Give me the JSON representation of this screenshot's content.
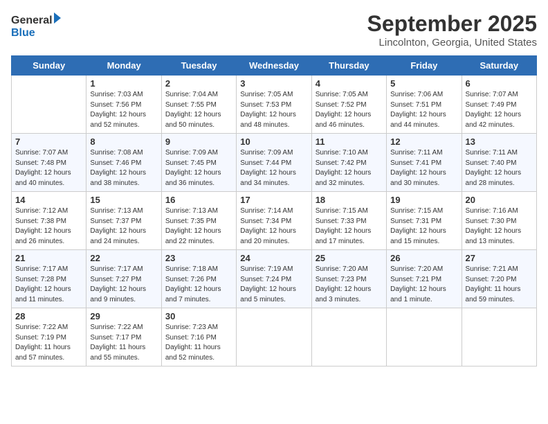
{
  "logo": {
    "line1": "General",
    "line2": "Blue"
  },
  "title": "September 2025",
  "location": "Lincolnton, Georgia, United States",
  "days_of_week": [
    "Sunday",
    "Monday",
    "Tuesday",
    "Wednesday",
    "Thursday",
    "Friday",
    "Saturday"
  ],
  "weeks": [
    [
      {
        "day": "",
        "info": ""
      },
      {
        "day": "1",
        "info": "Sunrise: 7:03 AM\nSunset: 7:56 PM\nDaylight: 12 hours\nand 52 minutes."
      },
      {
        "day": "2",
        "info": "Sunrise: 7:04 AM\nSunset: 7:55 PM\nDaylight: 12 hours\nand 50 minutes."
      },
      {
        "day": "3",
        "info": "Sunrise: 7:05 AM\nSunset: 7:53 PM\nDaylight: 12 hours\nand 48 minutes."
      },
      {
        "day": "4",
        "info": "Sunrise: 7:05 AM\nSunset: 7:52 PM\nDaylight: 12 hours\nand 46 minutes."
      },
      {
        "day": "5",
        "info": "Sunrise: 7:06 AM\nSunset: 7:51 PM\nDaylight: 12 hours\nand 44 minutes."
      },
      {
        "day": "6",
        "info": "Sunrise: 7:07 AM\nSunset: 7:49 PM\nDaylight: 12 hours\nand 42 minutes."
      }
    ],
    [
      {
        "day": "7",
        "info": "Sunrise: 7:07 AM\nSunset: 7:48 PM\nDaylight: 12 hours\nand 40 minutes."
      },
      {
        "day": "8",
        "info": "Sunrise: 7:08 AM\nSunset: 7:46 PM\nDaylight: 12 hours\nand 38 minutes."
      },
      {
        "day": "9",
        "info": "Sunrise: 7:09 AM\nSunset: 7:45 PM\nDaylight: 12 hours\nand 36 minutes."
      },
      {
        "day": "10",
        "info": "Sunrise: 7:09 AM\nSunset: 7:44 PM\nDaylight: 12 hours\nand 34 minutes."
      },
      {
        "day": "11",
        "info": "Sunrise: 7:10 AM\nSunset: 7:42 PM\nDaylight: 12 hours\nand 32 minutes."
      },
      {
        "day": "12",
        "info": "Sunrise: 7:11 AM\nSunset: 7:41 PM\nDaylight: 12 hours\nand 30 minutes."
      },
      {
        "day": "13",
        "info": "Sunrise: 7:11 AM\nSunset: 7:40 PM\nDaylight: 12 hours\nand 28 minutes."
      }
    ],
    [
      {
        "day": "14",
        "info": "Sunrise: 7:12 AM\nSunset: 7:38 PM\nDaylight: 12 hours\nand 26 minutes."
      },
      {
        "day": "15",
        "info": "Sunrise: 7:13 AM\nSunset: 7:37 PM\nDaylight: 12 hours\nand 24 minutes."
      },
      {
        "day": "16",
        "info": "Sunrise: 7:13 AM\nSunset: 7:35 PM\nDaylight: 12 hours\nand 22 minutes."
      },
      {
        "day": "17",
        "info": "Sunrise: 7:14 AM\nSunset: 7:34 PM\nDaylight: 12 hours\nand 20 minutes."
      },
      {
        "day": "18",
        "info": "Sunrise: 7:15 AM\nSunset: 7:33 PM\nDaylight: 12 hours\nand 17 minutes."
      },
      {
        "day": "19",
        "info": "Sunrise: 7:15 AM\nSunset: 7:31 PM\nDaylight: 12 hours\nand 15 minutes."
      },
      {
        "day": "20",
        "info": "Sunrise: 7:16 AM\nSunset: 7:30 PM\nDaylight: 12 hours\nand 13 minutes."
      }
    ],
    [
      {
        "day": "21",
        "info": "Sunrise: 7:17 AM\nSunset: 7:28 PM\nDaylight: 12 hours\nand 11 minutes."
      },
      {
        "day": "22",
        "info": "Sunrise: 7:17 AM\nSunset: 7:27 PM\nDaylight: 12 hours\nand 9 minutes."
      },
      {
        "day": "23",
        "info": "Sunrise: 7:18 AM\nSunset: 7:26 PM\nDaylight: 12 hours\nand 7 minutes."
      },
      {
        "day": "24",
        "info": "Sunrise: 7:19 AM\nSunset: 7:24 PM\nDaylight: 12 hours\nand 5 minutes."
      },
      {
        "day": "25",
        "info": "Sunrise: 7:20 AM\nSunset: 7:23 PM\nDaylight: 12 hours\nand 3 minutes."
      },
      {
        "day": "26",
        "info": "Sunrise: 7:20 AM\nSunset: 7:21 PM\nDaylight: 12 hours\nand 1 minute."
      },
      {
        "day": "27",
        "info": "Sunrise: 7:21 AM\nSunset: 7:20 PM\nDaylight: 11 hours\nand 59 minutes."
      }
    ],
    [
      {
        "day": "28",
        "info": "Sunrise: 7:22 AM\nSunset: 7:19 PM\nDaylight: 11 hours\nand 57 minutes."
      },
      {
        "day": "29",
        "info": "Sunrise: 7:22 AM\nSunset: 7:17 PM\nDaylight: 11 hours\nand 55 minutes."
      },
      {
        "day": "30",
        "info": "Sunrise: 7:23 AM\nSunset: 7:16 PM\nDaylight: 11 hours\nand 52 minutes."
      },
      {
        "day": "",
        "info": ""
      },
      {
        "day": "",
        "info": ""
      },
      {
        "day": "",
        "info": ""
      },
      {
        "day": "",
        "info": ""
      }
    ]
  ]
}
